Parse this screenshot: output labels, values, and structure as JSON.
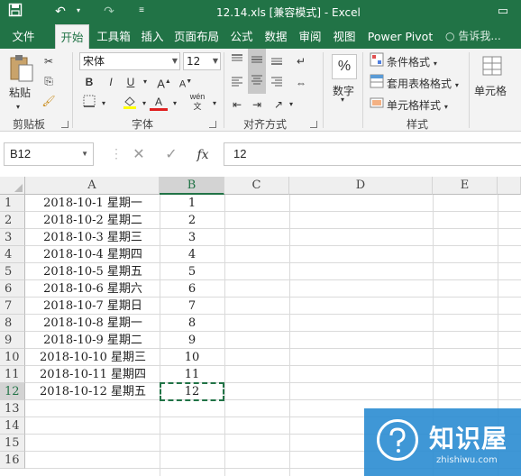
{
  "window": {
    "title": "12.14.xls  [兼容模式] - Excel",
    "accent": "#217346"
  },
  "quick_access": {
    "save_icon": "save-icon",
    "undo_icon": "undo-icon",
    "redo_icon": "redo-icon",
    "customize_icon": "customize-icon"
  },
  "tabs": [
    {
      "label": "文件"
    },
    {
      "label": "开始"
    },
    {
      "label": "工具箱"
    },
    {
      "label": "插入"
    },
    {
      "label": "页面布局"
    },
    {
      "label": "公式"
    },
    {
      "label": "数据"
    },
    {
      "label": "审阅"
    },
    {
      "label": "视图"
    },
    {
      "label": "Power Pivot"
    }
  ],
  "tell_me": "告诉我...",
  "ribbon": {
    "clipboard": {
      "paste": "粘贴",
      "label": "剪贴板"
    },
    "font": {
      "name": "宋体",
      "size": "12",
      "bold": "B",
      "italic": "I",
      "underline": "U",
      "font_color": "A",
      "wen": "wén",
      "label": "字体"
    },
    "alignment": {
      "label": "对齐方式"
    },
    "number": {
      "pct": "%",
      "label": "数字"
    },
    "styles": {
      "conditional": "条件格式",
      "table": "套用表格格式",
      "cell_styles": "单元格样式",
      "label": "样式"
    },
    "cells": {
      "label": "单元格"
    }
  },
  "formula_bar": {
    "name_box": "B12",
    "cancel": "✕",
    "enter": "✓",
    "fx": "fx",
    "value": "12"
  },
  "columns": [
    "A",
    "B",
    "C",
    "D",
    "E"
  ],
  "rows": [
    {
      "n": "1",
      "a": "2018-10-1  星期一",
      "b": "1"
    },
    {
      "n": "2",
      "a": "2018-10-2  星期二",
      "b": "2"
    },
    {
      "n": "3",
      "a": "2018-10-3  星期三",
      "b": "3"
    },
    {
      "n": "4",
      "a": "2018-10-4  星期四",
      "b": "4"
    },
    {
      "n": "5",
      "a": "2018-10-5  星期五",
      "b": "5"
    },
    {
      "n": "6",
      "a": "2018-10-6  星期六",
      "b": "6"
    },
    {
      "n": "7",
      "a": "2018-10-7  星期日",
      "b": "7"
    },
    {
      "n": "8",
      "a": "2018-10-8  星期一",
      "b": "8"
    },
    {
      "n": "9",
      "a": "2018-10-9  星期二",
      "b": "9"
    },
    {
      "n": "10",
      "a": "2018-10-10  星期三",
      "b": "10"
    },
    {
      "n": "11",
      "a": "2018-10-11  星期四",
      "b": "11"
    },
    {
      "n": "12",
      "a": "2018-10-12  星期五",
      "b": "12"
    },
    {
      "n": "13",
      "a": "",
      "b": ""
    },
    {
      "n": "14",
      "a": "",
      "b": ""
    },
    {
      "n": "15",
      "a": "",
      "b": ""
    },
    {
      "n": "16",
      "a": "",
      "b": ""
    }
  ],
  "watermark": {
    "big": "知识屋",
    "small": "zhishiwu.com"
  }
}
